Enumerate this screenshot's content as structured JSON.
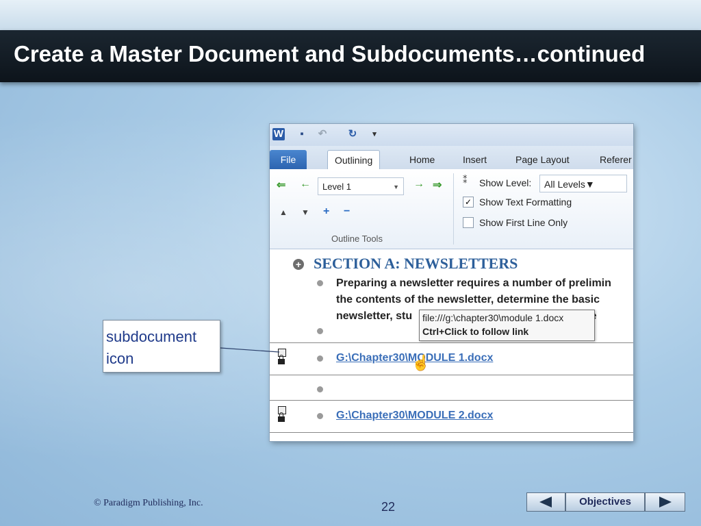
{
  "slide": {
    "title": "Create a Master Document and Subdocuments…continued",
    "copyright": "© Paradigm Publishing, Inc.",
    "page_number": "22",
    "nav": {
      "objectives_label": "Objectives"
    },
    "callout": {
      "line1": "subdocument",
      "line2": "icon"
    }
  },
  "word": {
    "qat": {
      "app_icon": "W"
    },
    "tabs": [
      "File",
      "Outlining",
      "Home",
      "Insert",
      "Page Layout",
      "Referer"
    ],
    "active_tab": "Outlining",
    "ribbon": {
      "level_value": "Level 1",
      "show_level_label": "Show Level:",
      "show_level_value": "All Levels",
      "show_text_formatting": "Show Text Formatting",
      "show_text_formatting_checked": true,
      "show_first_line_only": "Show First Line Only",
      "show_first_line_only_checked": false,
      "group_label": "Outline Tools"
    },
    "document": {
      "heading": "SECTION A: NEWSLETTERS",
      "para_lines": [
        "Preparing a newsletter requires a number of prelimin",
        "the contents of the newsletter, determine the basic",
        "newsletter, stu"
      ],
      "para_line3_tail": "ermine",
      "tooltip_path": "file:///g:\\chapter30\\module 1.docx",
      "tooltip_hint": "Ctrl+Click to follow link",
      "subdoc1": "G:\\Chapter30\\MODULE 1.docx",
      "subdoc2": "G:\\Chapter30\\MODULE 2.docx"
    }
  }
}
